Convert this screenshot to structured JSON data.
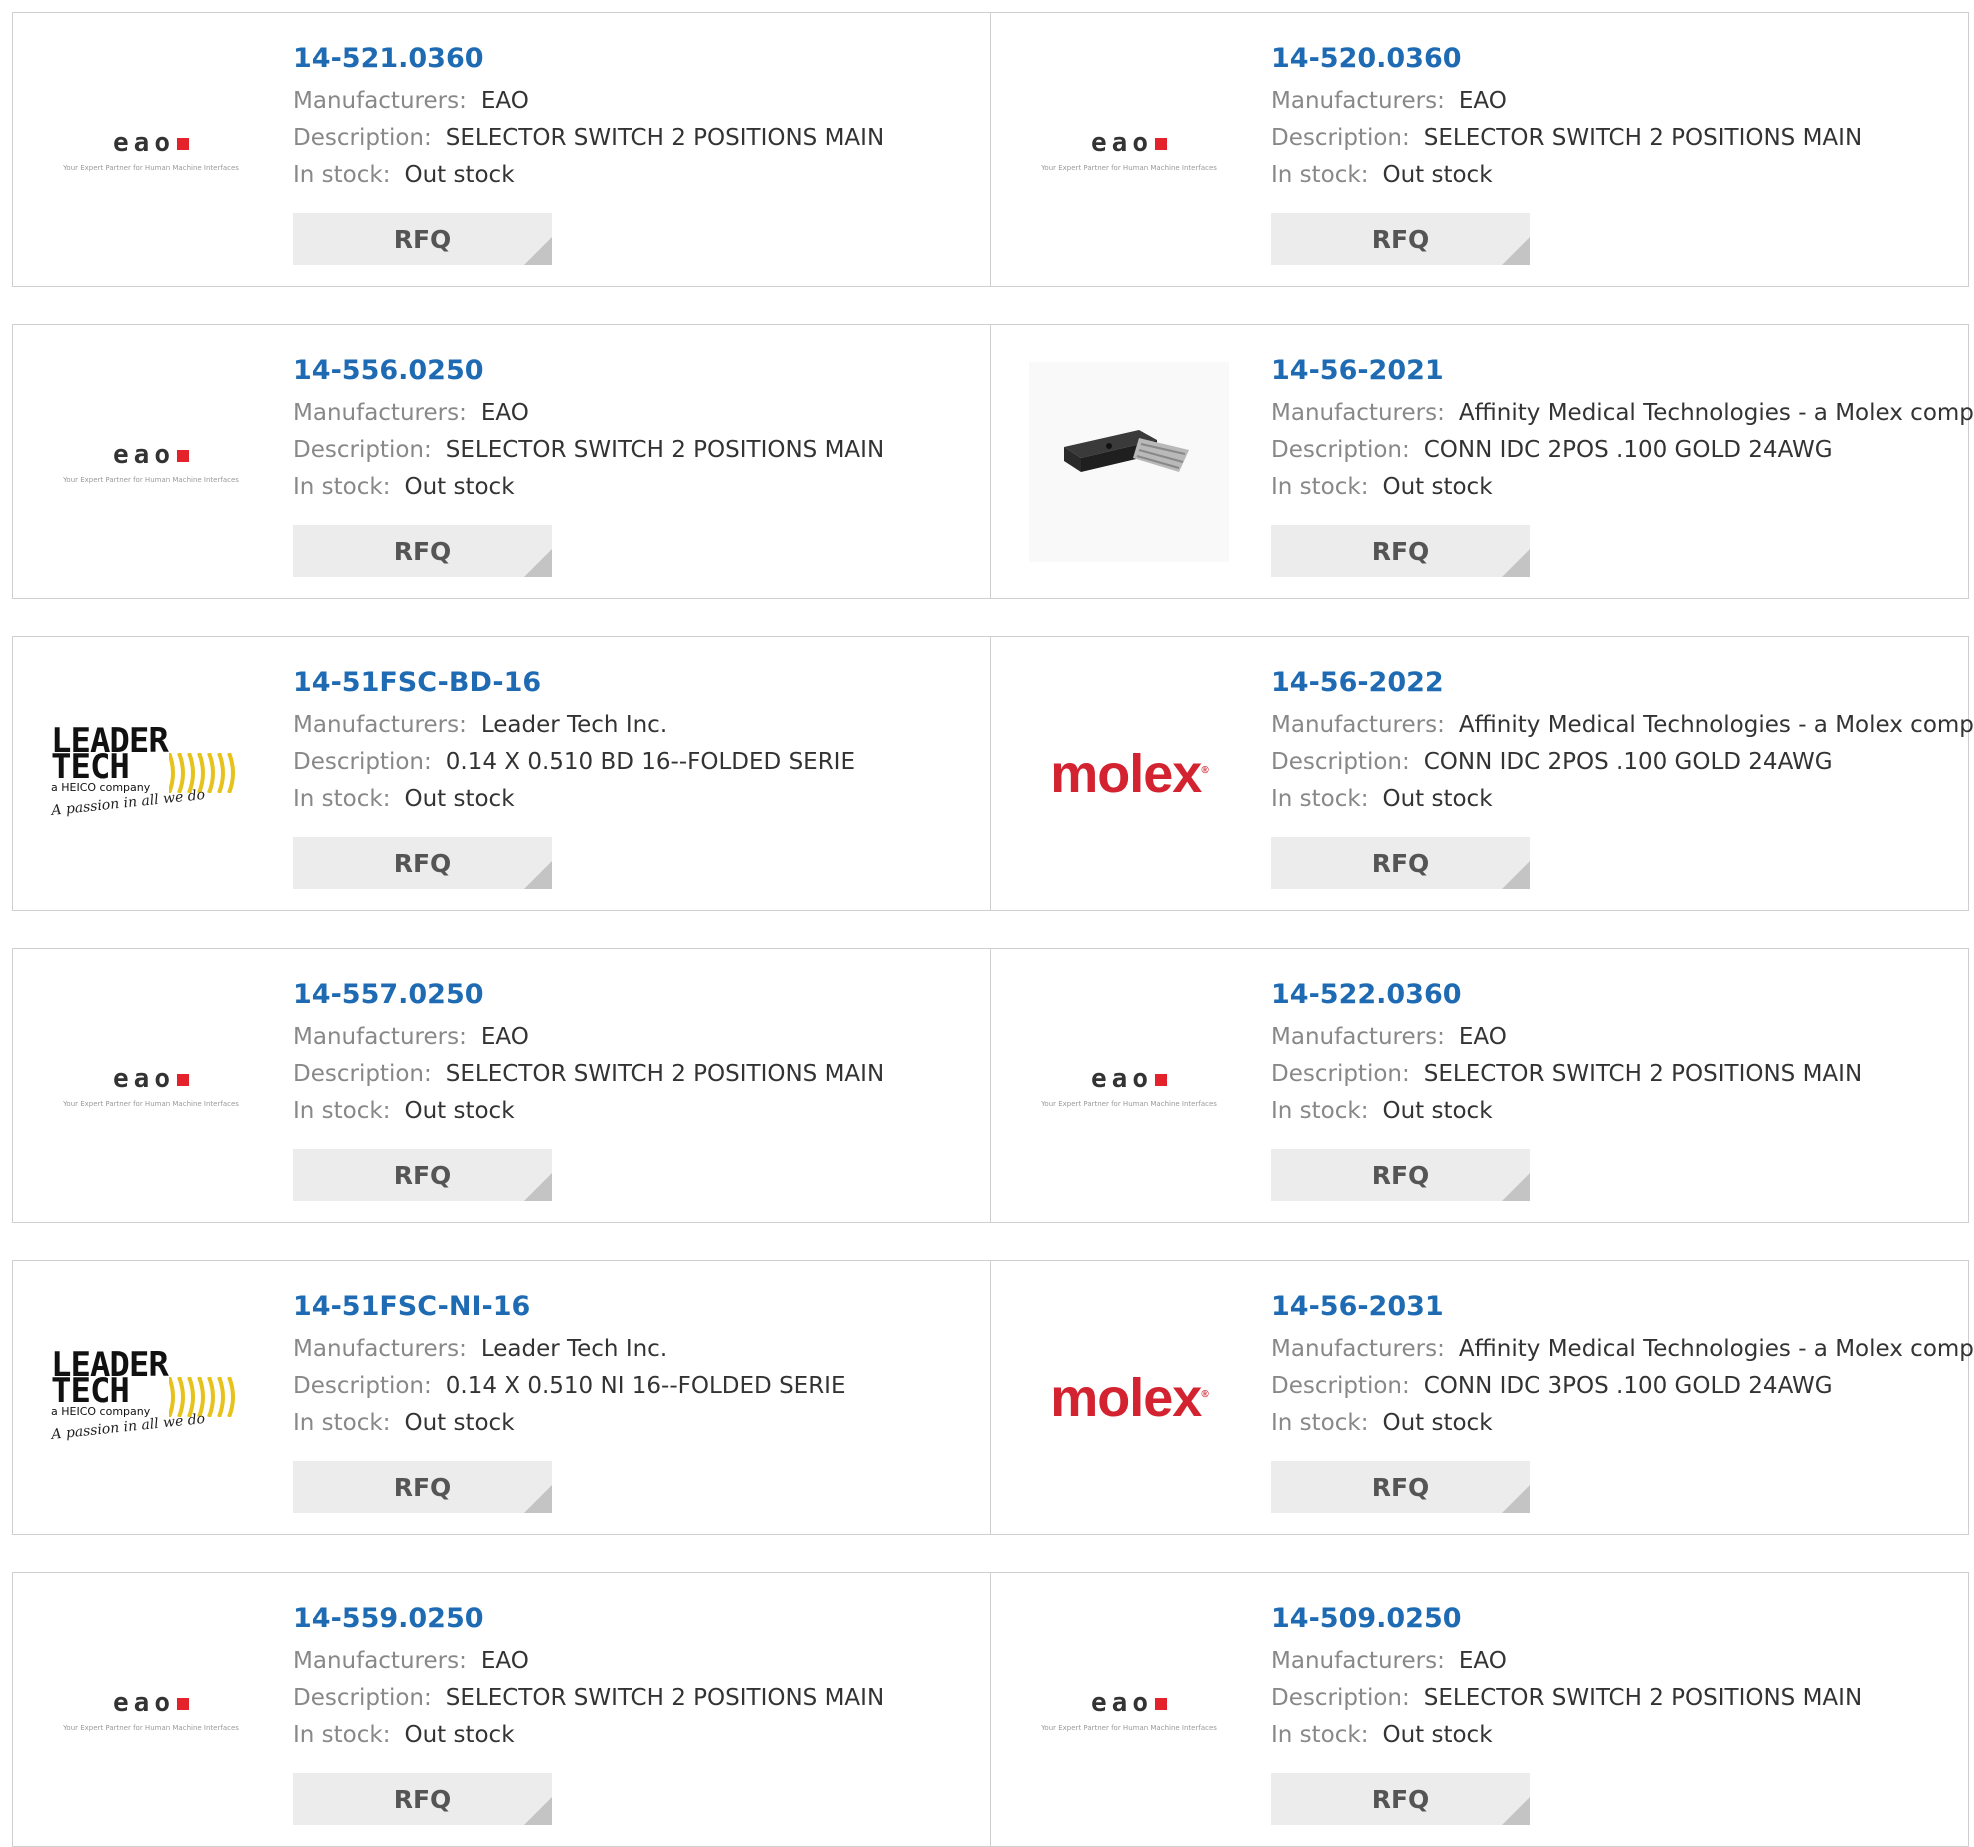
{
  "labels": {
    "manufacturers": "Manufacturers:",
    "description": "Description:",
    "in_stock": "In stock:",
    "rfq": "RFQ"
  },
  "logos": {
    "eao_word": "eao",
    "eao_tagline": "Your Expert Partner for Human Machine Interfaces",
    "leader_line1": "LEADER",
    "leader_line2": "TECH",
    "leader_heico": "a HEICO company",
    "leader_slogan": "A passion in all we do",
    "molex_word": "molex"
  },
  "colors": {
    "part_number": "#1e6bb3",
    "eao_red": "#e4222b",
    "molex_red": "#d42330",
    "leader_yellow": "#e6c21a"
  },
  "products": [
    {
      "part": "14-521.0360",
      "manufacturer": "EAO",
      "description": "SELECTOR SWITCH 2 POSITIONS MAIN",
      "stock": "Out stock",
      "logo": "eao-logo"
    },
    {
      "part": "14-520.0360",
      "manufacturer": "EAO",
      "description": "SELECTOR SWITCH 2 POSITIONS MAIN",
      "stock": "Out stock",
      "logo": "eao-logo"
    },
    {
      "part": "14-556.0250",
      "manufacturer": "EAO",
      "description": "SELECTOR SWITCH 2 POSITIONS MAIN",
      "stock": "Out stock",
      "logo": "eao-logo"
    },
    {
      "part": "14-56-2021",
      "manufacturer": "Affinity Medical Technologies - a Molex company",
      "description": "CONN IDC 2POS .100 GOLD 24AWG",
      "stock": "Out stock",
      "logo": "connector-photo"
    },
    {
      "part": "14-51FSC-BD-16",
      "manufacturer": "Leader Tech Inc.",
      "description": "0.14 X 0.510 BD 16--FOLDED SERIE",
      "stock": "Out stock",
      "logo": "leader-tech-logo"
    },
    {
      "part": "14-56-2022",
      "manufacturer": "Affinity Medical Technologies - a Molex company",
      "description": "CONN IDC 2POS .100 GOLD 24AWG",
      "stock": "Out stock",
      "logo": "molex-logo"
    },
    {
      "part": "14-557.0250",
      "manufacturer": "EAO",
      "description": "SELECTOR SWITCH 2 POSITIONS MAIN",
      "stock": "Out stock",
      "logo": "eao-logo"
    },
    {
      "part": "14-522.0360",
      "manufacturer": "EAO",
      "description": "SELECTOR SWITCH 2 POSITIONS MAIN",
      "stock": "Out stock",
      "logo": "eao-logo"
    },
    {
      "part": "14-51FSC-NI-16",
      "manufacturer": "Leader Tech Inc.",
      "description": "0.14 X 0.510 NI 16--FOLDED SERIE",
      "stock": "Out stock",
      "logo": "leader-tech-logo"
    },
    {
      "part": "14-56-2031",
      "manufacturer": "Affinity Medical Technologies - a Molex company",
      "description": "CONN IDC 3POS .100 GOLD 24AWG",
      "stock": "Out stock",
      "logo": "molex-logo"
    },
    {
      "part": "14-559.0250",
      "manufacturer": "EAO",
      "description": "SELECTOR SWITCH 2 POSITIONS MAIN",
      "stock": "Out stock",
      "logo": "eao-logo"
    },
    {
      "part": "14-509.0250",
      "manufacturer": "EAO",
      "description": "SELECTOR SWITCH 2 POSITIONS MAIN",
      "stock": "Out stock",
      "logo": "eao-logo"
    }
  ]
}
